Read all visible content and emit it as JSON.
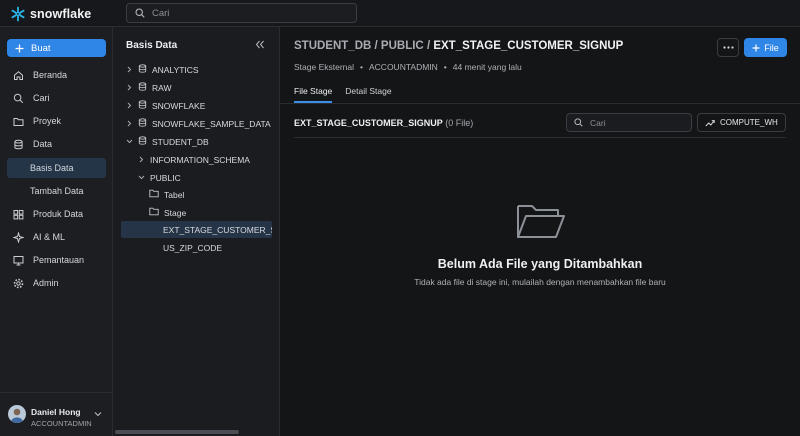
{
  "brand": {
    "name": "snowflake",
    "accent": "#2f86e6",
    "logo_color": "#29b5e8"
  },
  "top_search": {
    "placeholder": "Cari"
  },
  "nav": {
    "create_label": "Buat",
    "items": [
      {
        "label": "Beranda",
        "icon": "home-icon"
      },
      {
        "label": "Cari",
        "icon": "search-icon"
      },
      {
        "label": "Proyek",
        "icon": "folder-icon"
      },
      {
        "label": "Data",
        "icon": "database-icon"
      },
      {
        "label": "Basis Data",
        "icon": "",
        "sub": true,
        "active": true
      },
      {
        "label": "Tambah Data",
        "icon": "",
        "sub": true
      },
      {
        "label": "Produk Data",
        "icon": "cloud-icon"
      },
      {
        "label": "AI & ML",
        "icon": "sparkle-icon"
      },
      {
        "label": "Pemantauan",
        "icon": "monitor-icon"
      },
      {
        "label": "Admin",
        "icon": "gear-icon"
      }
    ]
  },
  "user": {
    "name": "Daniel Hong",
    "role": "ACCOUNTADMIN"
  },
  "tree": {
    "title": "Basis Data",
    "items": [
      {
        "label": "ANALYTICS",
        "level": 0,
        "kind": "db",
        "expanded": false
      },
      {
        "label": "RAW",
        "level": 0,
        "kind": "db",
        "expanded": false
      },
      {
        "label": "SNOWFLAKE",
        "level": 0,
        "kind": "db",
        "expanded": false
      },
      {
        "label": "SNOWFLAKE_SAMPLE_DATA",
        "level": 0,
        "kind": "db",
        "expanded": false
      },
      {
        "label": "STUDENT_DB",
        "level": 0,
        "kind": "db",
        "expanded": true
      },
      {
        "label": "INFORMATION_SCHEMA",
        "level": 1,
        "kind": "schema",
        "expanded": false
      },
      {
        "label": "PUBLIC",
        "level": 1,
        "kind": "schema",
        "expanded": true
      },
      {
        "label": "Tabel",
        "level": 2,
        "kind": "folder"
      },
      {
        "label": "Stage",
        "level": 2,
        "kind": "folder"
      },
      {
        "label": "EXT_STAGE_CUSTOMER_SIGNUP",
        "level": 3,
        "kind": "item",
        "selected": true
      },
      {
        "label": "US_ZIP_CODE",
        "level": 3,
        "kind": "item"
      }
    ]
  },
  "main": {
    "breadcrumb": {
      "db": "STUDENT_DB",
      "schema": "PUBLIC",
      "current": "EXT_STAGE_CUSTOMER_SIGNUP",
      "sep": "/"
    },
    "meta": {
      "type": "Stage Eksternal",
      "role": "ACCOUNTADMIN",
      "time": "44 menit yang lalu",
      "dot": "•"
    },
    "file_button": "File",
    "tabs": [
      {
        "label": "File Stage",
        "active": true
      },
      {
        "label": "Detail Stage",
        "active": false
      }
    ],
    "section": {
      "name": "EXT_STAGE_CUSTOMER_SIGNUP",
      "count": "(0 File)"
    },
    "search_placeholder": "Cari",
    "warehouse": "COMPUTE_WH",
    "empty": {
      "title": "Belum Ada File yang Ditambahkan",
      "desc": "Tidak ada file di stage ini, mulailah dengan menambahkan file baru"
    }
  }
}
